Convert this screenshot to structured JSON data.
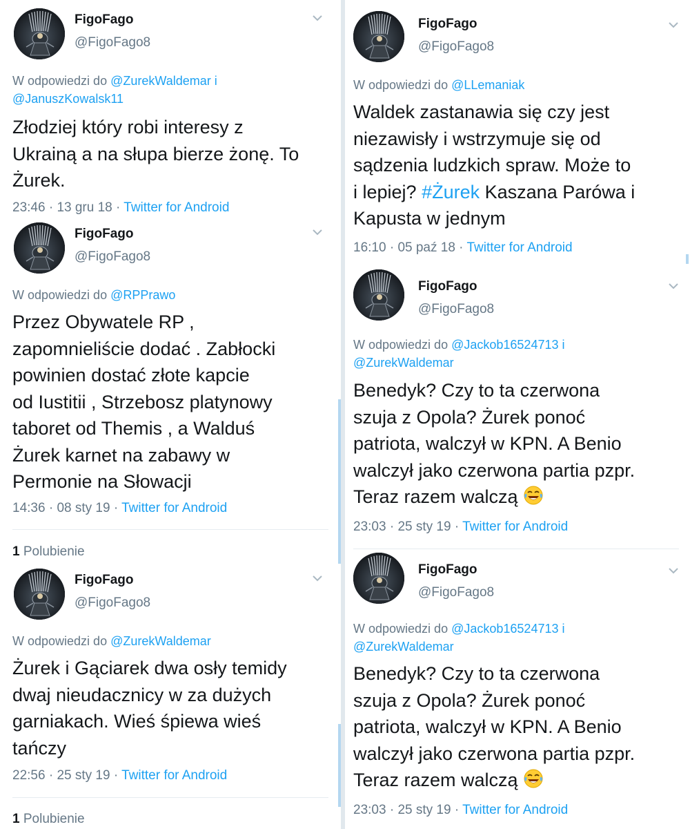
{
  "colors": {
    "link": "#1da1f2",
    "muted": "#657786",
    "text": "#14171a",
    "divider": "#e1e8ed"
  },
  "icons": {
    "caret": "chevron-down-icon",
    "avatar": "profile-avatar",
    "emoji": "face-with-tears-of-joy-emoji"
  },
  "left": {
    "tweets": [
      {
        "name": "FigoFago",
        "handle": "@FigoFago8",
        "reply_prefix": "W odpowiedzi do",
        "reply_to_1": "@ZurekWaldemar",
        "reply_joiner": "i",
        "reply_to_2": "@JanuszKowalsk11",
        "lines": [
          "Złodziej który robi interesy z",
          "Ukrainą a na słupa bierze żonę. To",
          "Żurek."
        ],
        "time": "23:46",
        "date": "13 gru 18",
        "source": "Twitter for Android"
      },
      {
        "name": "FigoFago",
        "handle": "@FigoFago8",
        "reply_prefix": "W odpowiedzi do",
        "reply_to_1": "@RPPrawo",
        "lines": [
          "Przez Obywatele RP ,",
          "zapomnieliście dodać . Zabłocki",
          "powinien dostać złote kapcie",
          "od Iustitii , Strzebosz platynowy",
          "taboret od Themis , a Walduś",
          "Żurek karnet na zabawy w",
          "Permonie na Słowacji"
        ],
        "time": "14:36",
        "date": "08 sty 19",
        "source": "Twitter for Android",
        "likes_count": "1",
        "likes_label": "Polubienie"
      },
      {
        "name": "FigoFago",
        "handle": "@FigoFago8",
        "reply_prefix": "W odpowiedzi do",
        "reply_to_1": "@ZurekWaldemar",
        "lines": [
          "Żurek i Gąciarek dwa osły temidy",
          "dwaj nieudacznicy w za dużych",
          "garniakach. Wieś śpiewa wieś",
          "tańczy"
        ],
        "time": "22:56",
        "date": "25 sty 19",
        "source": "Twitter for Android",
        "likes_count": "1",
        "likes_label": "Polubienie"
      }
    ]
  },
  "right": {
    "tweets": [
      {
        "name": "FigoFago",
        "handle": "@FigoFago8",
        "reply_prefix": "W odpowiedzi do",
        "reply_to_1": "@LLemaniak",
        "lines": [
          "Waldek zastanawia się czy jest",
          "niezawisły i wstrzymuje się od",
          "sądzenia ludzkich spraw. Może to"
        ],
        "line4_pre": "i lepiej?",
        "hashtag": "#Żurek",
        "line4_post": "Kaszana Parówa i",
        "line5": "Kapusta w jednym",
        "time": "16:10",
        "date": "05 paź 18",
        "source": "Twitter for Android"
      },
      {
        "name": "FigoFago",
        "handle": "@FigoFago8",
        "reply_prefix": "W odpowiedzi do",
        "reply_to_1": "@Jackob16524713",
        "reply_joiner": "i",
        "reply_to_2": "@ZurekWaldemar",
        "lines": [
          "Benedyk? Czy to ta czerwona",
          "szuja z Opola? Żurek ponoć",
          "patriota, walczył w KPN. A Benio",
          "walczył jako czerwona partia pzpr."
        ],
        "last_line": "Teraz razem walczą",
        "time": "23:03",
        "date": "25 sty 19",
        "source": "Twitter for Android"
      },
      {
        "name": "FigoFago",
        "handle": "@FigoFago8",
        "reply_prefix": "W odpowiedzi do",
        "reply_to_1": "@Jackob16524713",
        "reply_joiner": "i",
        "reply_to_2": "@ZurekWaldemar",
        "lines": [
          "Benedyk? Czy to ta czerwona",
          "szuja z Opola? Żurek ponoć",
          "patriota, walczył w KPN. A Benio",
          "walczył jako czerwona partia pzpr."
        ],
        "last_line": "Teraz razem walczą",
        "time": "23:03",
        "date": "25 sty 19",
        "source": "Twitter for Android"
      }
    ]
  }
}
